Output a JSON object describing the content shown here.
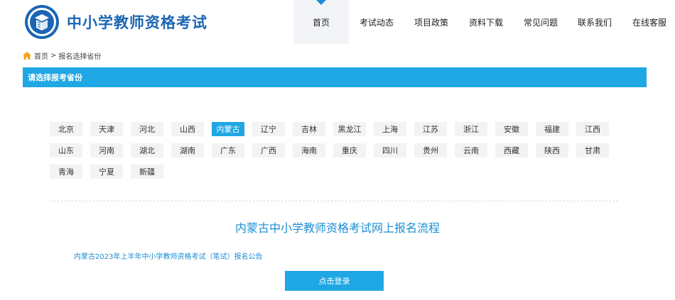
{
  "header": {
    "site_title": "中小学教师资格考试",
    "logo_icon": "teacher-cert-emblem-icon",
    "nav": [
      {
        "label": "首页",
        "active": true
      },
      {
        "label": "考试动态"
      },
      {
        "label": "项目政策"
      },
      {
        "label": "资料下载"
      },
      {
        "label": "常见问题"
      },
      {
        "label": "联系我们"
      },
      {
        "label": "在线客服"
      }
    ]
  },
  "breadcrumb": {
    "home": "首页",
    "separator": ">",
    "current": "报名选择省份"
  },
  "section": {
    "title": "请选择报考省份"
  },
  "provinces": {
    "row1": [
      "北京",
      "天津",
      "河北",
      "山西",
      "内蒙古",
      "辽宁",
      "吉林",
      "黑龙江",
      "上海",
      "江苏",
      "浙江",
      "安徽",
      "福建",
      "江西"
    ],
    "row2": [
      "山东",
      "河南",
      "湖北",
      "湖南",
      "广东",
      "广西",
      "海南",
      "重庆",
      "四川",
      "贵州",
      "云南",
      "西藏",
      "陕西",
      "甘肃"
    ],
    "row3": [
      "青海",
      "宁夏",
      "新疆"
    ],
    "selected": "内蒙古"
  },
  "content": {
    "flow_title": "内蒙古中小学教师资格考试网上报名流程",
    "notice_link": "内蒙古2023年上半年中小学教师资格考试（笔试）报名公告",
    "login_label": "点击登录"
  },
  "colors": {
    "brand_blue": "#1b66b3",
    "accent": "#1ea7e3"
  }
}
